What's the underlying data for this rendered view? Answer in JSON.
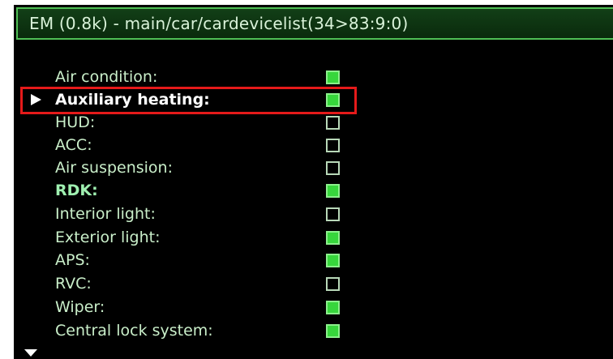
{
  "title": "EM (0.8k) - main/car/cardevicelist(34>83:9:0)",
  "items": [
    {
      "label": "Air condition:",
      "checked": true
    },
    {
      "label": "Auxiliary heating:",
      "checked": true,
      "selected": true
    },
    {
      "label": "HUD:",
      "checked": false
    },
    {
      "label": "ACC:",
      "checked": false
    },
    {
      "label": "Air suspension:",
      "checked": false
    },
    {
      "label": "RDK:",
      "checked": true
    },
    {
      "label": "Interior light:",
      "checked": false
    },
    {
      "label": "Exterior light:",
      "checked": true
    },
    {
      "label": "APS:",
      "checked": true
    },
    {
      "label": "RVC:",
      "checked": false
    },
    {
      "label": "Wiper:",
      "checked": true
    },
    {
      "label": "Central lock system:",
      "checked": true
    }
  ],
  "colors": {
    "highlight_box": "#e51a1a",
    "checkbox_on": "#37d63c",
    "text": "#c9eec9"
  }
}
